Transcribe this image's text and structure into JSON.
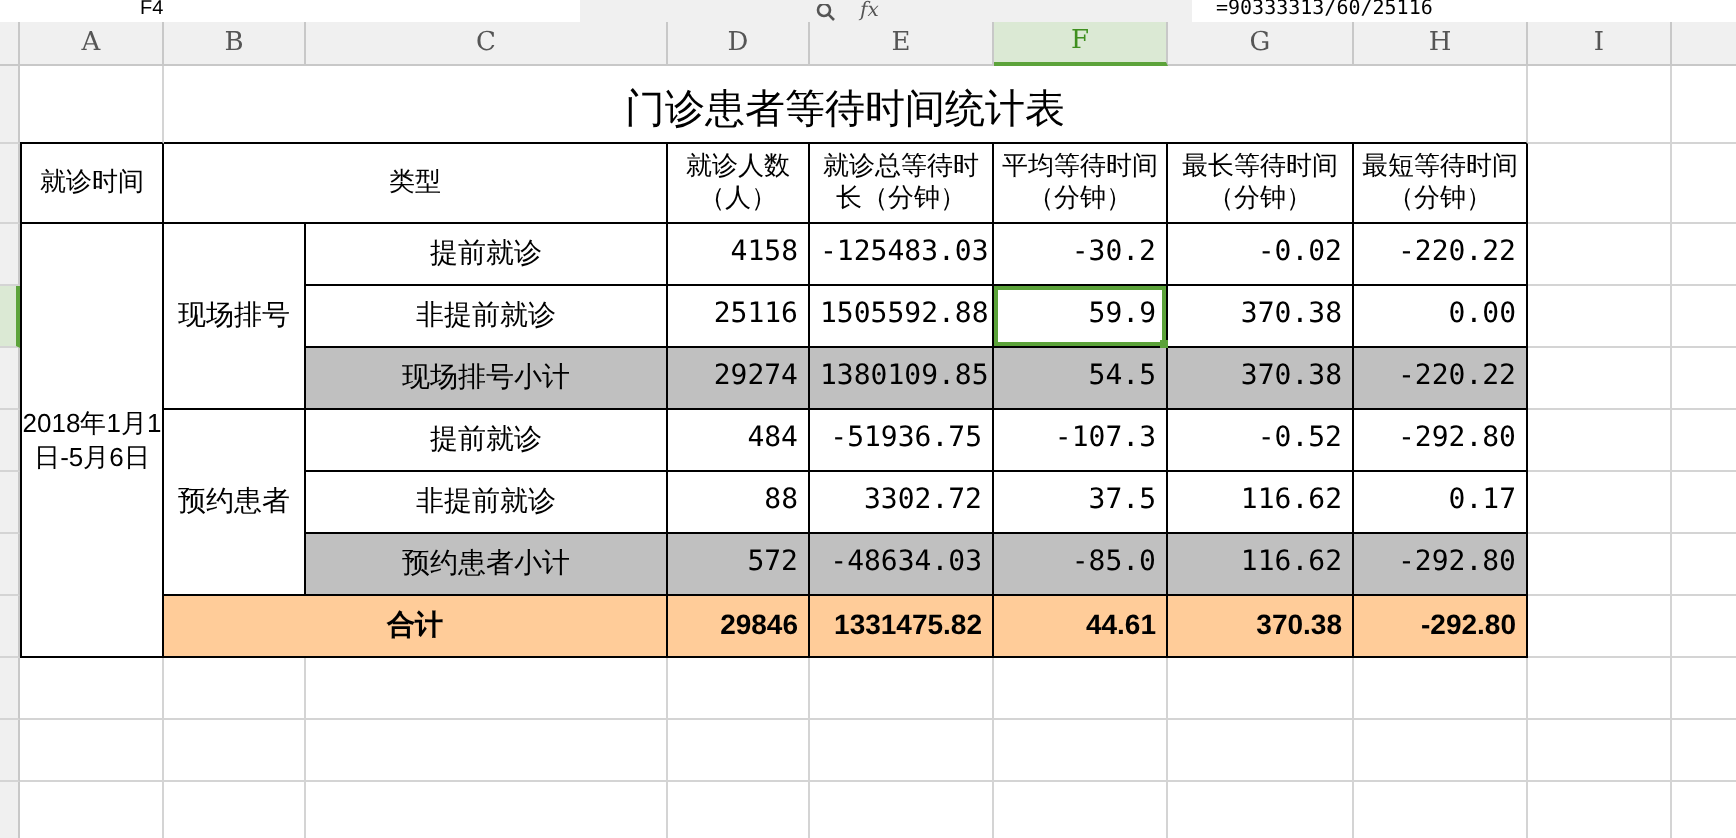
{
  "formula_bar": {
    "name_box": "F4",
    "function_label": "fx",
    "formula": "=90333313/60/25116"
  },
  "columns": [
    {
      "label": "A",
      "selected": false
    },
    {
      "label": "B",
      "selected": false
    },
    {
      "label": "C",
      "selected": false
    },
    {
      "label": "D",
      "selected": false
    },
    {
      "label": "E",
      "selected": false
    },
    {
      "label": "F",
      "selected": true
    },
    {
      "label": "G",
      "selected": false
    },
    {
      "label": "H",
      "selected": false
    },
    {
      "label": "I",
      "selected": false
    }
  ],
  "title": "门诊患者等待时间统计表",
  "header": {
    "time": "就诊时间",
    "type": "类型",
    "metrics": [
      [
        "就诊人数",
        "（人）"
      ],
      [
        "就诊总等待时",
        "长（分钟）"
      ],
      [
        "平均等待时间",
        "（分钟）"
      ],
      [
        "最长等待时间",
        "（分钟）"
      ],
      [
        "最短等待时间",
        "（分钟）"
      ]
    ]
  },
  "period": "2018年1月1日-5月6日",
  "groups": [
    {
      "label": "现场排号",
      "rows": [
        {
          "kind": "detail",
          "label": "提前就诊",
          "cells": [
            {
              "text": "4158",
              "selected": false
            },
            {
              "text": "-125483.03",
              "selected": false
            },
            {
              "text": "-30.2",
              "selected": false
            },
            {
              "text": "-0.02",
              "selected": false
            },
            {
              "text": "-220.22",
              "selected": false
            }
          ]
        },
        {
          "kind": "detail",
          "label": "非提前就诊",
          "cells": [
            {
              "text": "25116",
              "selected": false
            },
            {
              "text": "1505592.88",
              "selected": false
            },
            {
              "text": "59.9",
              "selected": true
            },
            {
              "text": "370.38",
              "selected": false
            },
            {
              "text": "0.00",
              "selected": false
            }
          ]
        },
        {
          "kind": "subtotal",
          "label": "现场排号小计",
          "cells": [
            {
              "text": "29274",
              "selected": false
            },
            {
              "text": "1380109.85",
              "selected": false
            },
            {
              "text": "54.5",
              "selected": false
            },
            {
              "text": "370.38",
              "selected": false
            },
            {
              "text": "-220.22",
              "selected": false
            }
          ]
        }
      ]
    },
    {
      "label": "预约患者",
      "rows": [
        {
          "kind": "detail",
          "label": "提前就诊",
          "cells": [
            {
              "text": "484",
              "selected": false
            },
            {
              "text": "-51936.75",
              "selected": false
            },
            {
              "text": "-107.3",
              "selected": false
            },
            {
              "text": "-0.52",
              "selected": false
            },
            {
              "text": "-292.80",
              "selected": false
            }
          ]
        },
        {
          "kind": "detail",
          "label": "非提前就诊",
          "cells": [
            {
              "text": "88",
              "selected": false
            },
            {
              "text": "3302.72",
              "selected": false
            },
            {
              "text": "37.5",
              "selected": false
            },
            {
              "text": "116.62",
              "selected": false
            },
            {
              "text": "0.17",
              "selected": false
            }
          ]
        },
        {
          "kind": "subtotal",
          "label": "预约患者小计",
          "cells": [
            {
              "text": "572",
              "selected": false
            },
            {
              "text": "-48634.03",
              "selected": false
            },
            {
              "text": "-85.0",
              "selected": false
            },
            {
              "text": "116.62",
              "selected": false
            },
            {
              "text": "-292.80",
              "selected": false
            }
          ]
        }
      ]
    }
  ],
  "total": {
    "label": "合计",
    "cells": [
      {
        "text": "29846",
        "selected": false
      },
      {
        "text": "1331475.82",
        "selected": false
      },
      {
        "text": "44.61",
        "selected": false
      },
      {
        "text": "370.38",
        "selected": false
      },
      {
        "text": "-292.80",
        "selected": false
      }
    ]
  }
}
